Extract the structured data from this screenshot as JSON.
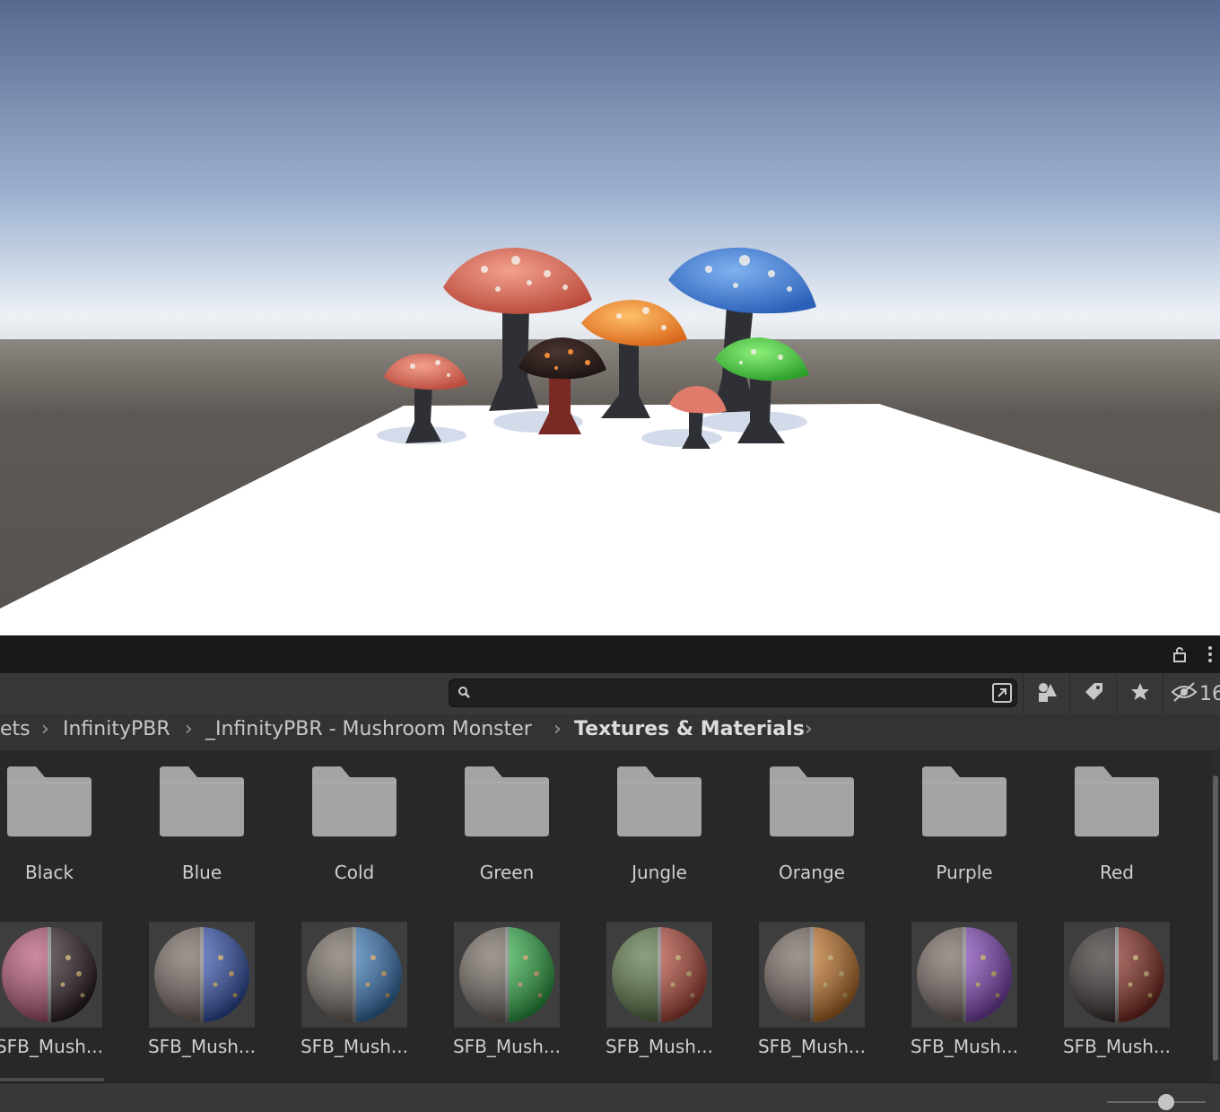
{
  "scene": {
    "sky_top": "#5a6d93",
    "sky_horizon": "#e8eef5",
    "ground": "#5c5753",
    "plane": "#ffffff",
    "mushrooms": [
      {
        "name": "red-large",
        "cap": "#d86a5a"
      },
      {
        "name": "blue-large",
        "cap": "#3f7ed6"
      },
      {
        "name": "orange",
        "cap": "#ee8a2c"
      },
      {
        "name": "black",
        "cap": "#2e2220"
      },
      {
        "name": "green",
        "cap": "#45c83a"
      },
      {
        "name": "red-small-left",
        "cap": "#c85a50"
      },
      {
        "name": "red-tiny",
        "cap": "#e07a6a"
      }
    ]
  },
  "project": {
    "search": {
      "value": "",
      "placeholder": ""
    },
    "hidden_count": "16",
    "breadcrumb": [
      {
        "label": "ets",
        "bold": false
      },
      {
        "label": "InfinityPBR",
        "bold": false
      },
      {
        "label": "_InfinityPBR - Mushroom Monster",
        "bold": false
      },
      {
        "label": "Textures & Materials",
        "bold": true
      }
    ],
    "folders": [
      "Black",
      "Blue",
      "Cold",
      "Green",
      "Jungle",
      "Orange",
      "Purple",
      "Red"
    ],
    "materials": [
      {
        "label": "SFB_Mush...",
        "accent": "#2a1a22",
        "stem": "#b04a70"
      },
      {
        "label": "SFB_Mush...",
        "accent": "#3355bb",
        "stem": "#6b5d55"
      },
      {
        "label": "SFB_Mush...",
        "accent": "#3a7ec4",
        "stem": "#6b6058"
      },
      {
        "label": "SFB_Mush...",
        "accent": "#2fb84a",
        "stem": "#6b6058"
      },
      {
        "label": "SFB_Mush...",
        "accent": "#c04a3a",
        "stem": "#4f6b38"
      },
      {
        "label": "SFB_Mush...",
        "accent": "#d07a28",
        "stem": "#6b5d55"
      },
      {
        "label": "SFB_Mush...",
        "accent": "#8a48c8",
        "stem": "#6b5d55"
      },
      {
        "label": "SFB_Mush...",
        "accent": "#8a2a1e",
        "stem": "#2a2220"
      }
    ],
    "zoom_level": 0.6
  }
}
